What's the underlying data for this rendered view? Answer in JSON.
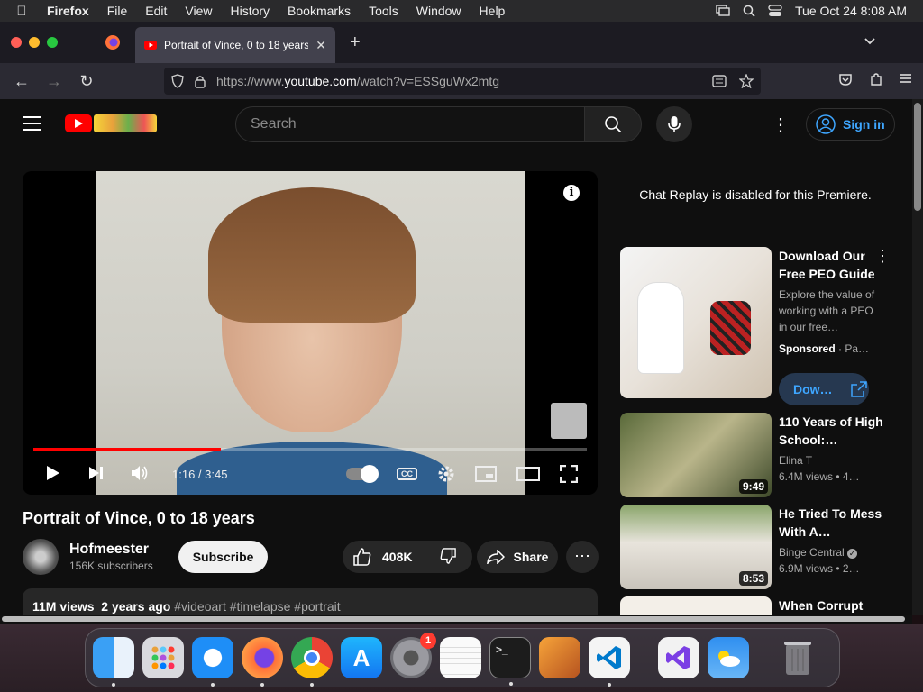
{
  "menubar": {
    "app": "Firefox",
    "menus": [
      "File",
      "Edit",
      "View",
      "History",
      "Bookmarks",
      "Tools",
      "Window",
      "Help"
    ],
    "datetime": "Tue Oct 24  8:08 AM"
  },
  "browser": {
    "tab_title": "Portrait of Vince, 0 to 18 years",
    "url_prefix": "https://www.",
    "url_domain": "youtube.com",
    "url_path": "/watch?v=ESSguWx2mtg"
  },
  "youtube": {
    "search_placeholder": "Search",
    "sign_in": "Sign in"
  },
  "player": {
    "time": "1:16 / 3:45",
    "progress_fraction": 0.338,
    "cc_label": "CC"
  },
  "video": {
    "title": "Portrait of Vince, 0 to 18 years",
    "channel": "Hofmeester",
    "subscribers": "156K subscribers",
    "subscribe_label": "Subscribe",
    "likes": "408K",
    "share_label": "Share",
    "views": "11M views",
    "age": "2 years ago",
    "tags": "#videoart #timelapse #portrait"
  },
  "sidebar": {
    "chat_replay": "Chat Replay is disabled for this Premiere.",
    "ad": {
      "title": "Download Our Free PEO Guide",
      "description": "Explore the value of working with a PEO in our free…",
      "sponsored": "Sponsored",
      "sponsored_rest": "· Pa…",
      "button": "Dow…"
    },
    "recommendations": [
      {
        "title": "110 Years of High School:…",
        "channel": "Elina T",
        "meta": "6.4M views  • 4…",
        "duration": "9:49",
        "verified": false
      },
      {
        "title": "He Tried To Mess With A…",
        "channel": "Binge Central",
        "meta": "6.9M views  • 2…",
        "duration": "8:53",
        "verified": true
      },
      {
        "title": "When Corrupt",
        "channel": "",
        "meta": "",
        "duration": "",
        "verified": false
      }
    ]
  },
  "dock": {
    "notification_badge": "1"
  }
}
